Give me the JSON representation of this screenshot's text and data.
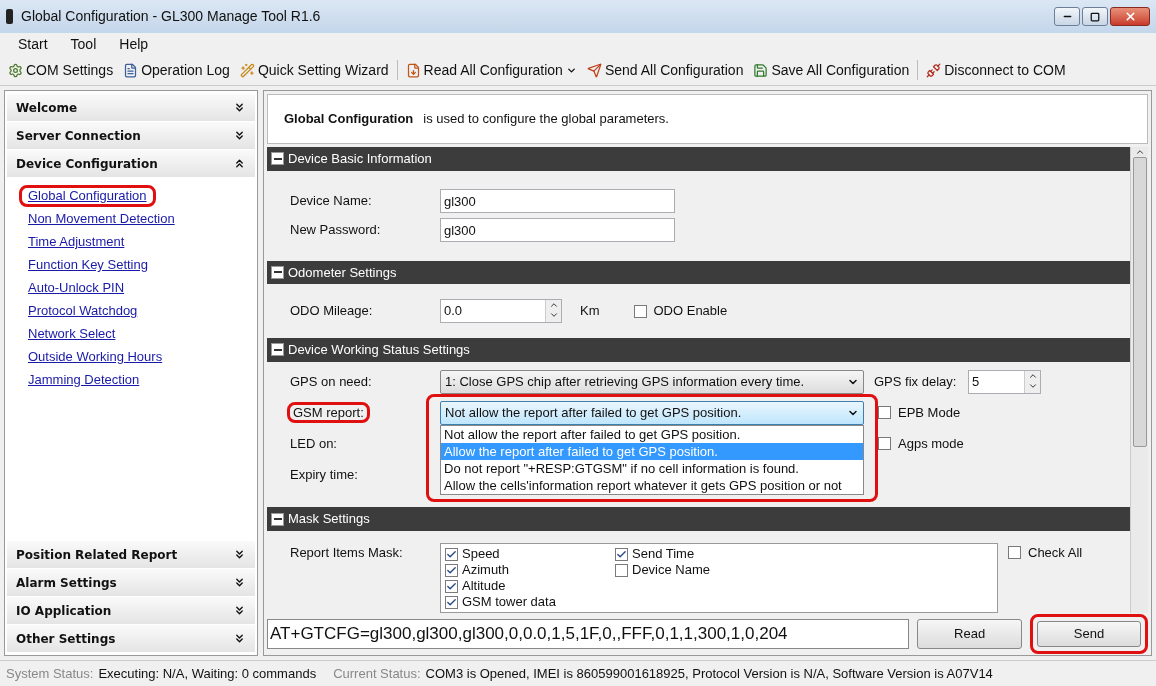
{
  "window": {
    "title": "Global Configuration - GL300 Manage Tool R1.6"
  },
  "menu": [
    "Start",
    "Tool",
    "Help"
  ],
  "toolbar": [
    {
      "kind": "gear",
      "label": "COM Settings"
    },
    {
      "kind": "log",
      "label": "Operation Log"
    },
    {
      "kind": "wizard",
      "label": "Quick Setting Wizard"
    },
    {
      "kind": "read",
      "label": "Read All Configuration",
      "dropdown": true
    },
    {
      "kind": "send",
      "label": "Send All Configuration"
    },
    {
      "kind": "save",
      "label": "Save All Configuration"
    },
    {
      "kind": "disconnect",
      "label": "Disconnect to COM"
    }
  ],
  "sidebar": {
    "top_groups": [
      {
        "label": "Welcome",
        "expanded": false
      },
      {
        "label": "Server Connection",
        "expanded": false
      },
      {
        "label": "Device Configuration",
        "expanded": true,
        "children": [
          {
            "label": "Global Configuration",
            "highlighted": true
          },
          {
            "label": "Non Movement Detection",
            "highlighted": false
          },
          {
            "label": "Time Adjustment",
            "highlighted": false
          },
          {
            "label": "Function Key Setting",
            "highlighted": false
          },
          {
            "label": "Auto-Unlock PIN",
            "highlighted": false
          },
          {
            "label": "Protocol Watchdog",
            "highlighted": false
          },
          {
            "label": "Network Select",
            "highlighted": false
          },
          {
            "label": "Outside Working Hours",
            "highlighted": false
          },
          {
            "label": "Jamming Detection",
            "highlighted": false
          }
        ]
      }
    ],
    "bottom_groups": [
      {
        "label": "Position Related Report",
        "expanded": false
      },
      {
        "label": "Alarm Settings",
        "expanded": false
      },
      {
        "label": "IO Application",
        "expanded": false
      },
      {
        "label": "Other Settings",
        "expanded": false
      }
    ]
  },
  "header": {
    "title": "Global Configuration",
    "description": "is used to configure the global parameters."
  },
  "sections": {
    "basic": {
      "title": "Device Basic Information",
      "device_name_label": "Device Name:",
      "device_name": "gl300",
      "password_label": "New Password:",
      "password": "gl300"
    },
    "odometer": {
      "title": "Odometer Settings",
      "mileage_label": "ODO Mileage:",
      "mileage": "0.0",
      "unit": "Km",
      "enable_label": "ODO Enable",
      "enable_checked": false
    },
    "working": {
      "title": "Device Working Status Settings",
      "gps_label": "GPS on need:",
      "gps_value": "1: Close GPS chip after retrieving GPS information every time.",
      "fix_delay_label": "GPS fix delay:",
      "fix_delay": "5",
      "gsm_label": "GSM report:",
      "gsm_label_highlighted": true,
      "gsm_value": "Not allow the report after failed to get GPS position.",
      "gsm_highlighted": true,
      "gsm_options": [
        {
          "label": "Not allow the report after failed to get GPS position.",
          "selected": false
        },
        {
          "label": "Allow the report after failed to get GPS position.",
          "selected": true
        },
        {
          "label": "Do not report \"+RESP:GTGSM\" if no cell information is found.",
          "selected": false
        },
        {
          "label": "Allow the cells'information report whatever it gets GPS position or not",
          "selected": false
        }
      ],
      "epb_label": "EPB Mode",
      "epb_checked": false,
      "led_label": "LED on:",
      "agps_label": "Agps mode",
      "agps_checked": false,
      "expiry_label": "Expiry time:"
    },
    "mask": {
      "title": "Mask Settings",
      "label": "Report Items Mask:",
      "items": [
        {
          "label": "Speed",
          "checked": true
        },
        {
          "label": "Azimuth",
          "checked": true
        },
        {
          "label": "Altitude",
          "checked": true
        },
        {
          "label": "GSM tower data",
          "checked": true
        },
        {
          "label": "Send Time",
          "checked": true
        },
        {
          "label": "Device Name",
          "checked": false
        }
      ],
      "check_all_label": "Check All",
      "check_all_checked": false
    }
  },
  "command": {
    "value": "AT+GTCFG=gl300,gl300,gl300,0,0.0,1,5,1F,0,,FFF,0,1,1,300,1,0,204",
    "read": "Read",
    "send": "Send",
    "send_highlighted": true
  },
  "status_bar": {
    "system_label": "System Status:",
    "system_value": "Executing: N/A, Waiting: 0 commands",
    "current_label": "Current Status:",
    "current_value": "COM3 is Opened, IMEI is 860599001618925, Protocol Version is N/A, Software Version is A07V14"
  }
}
